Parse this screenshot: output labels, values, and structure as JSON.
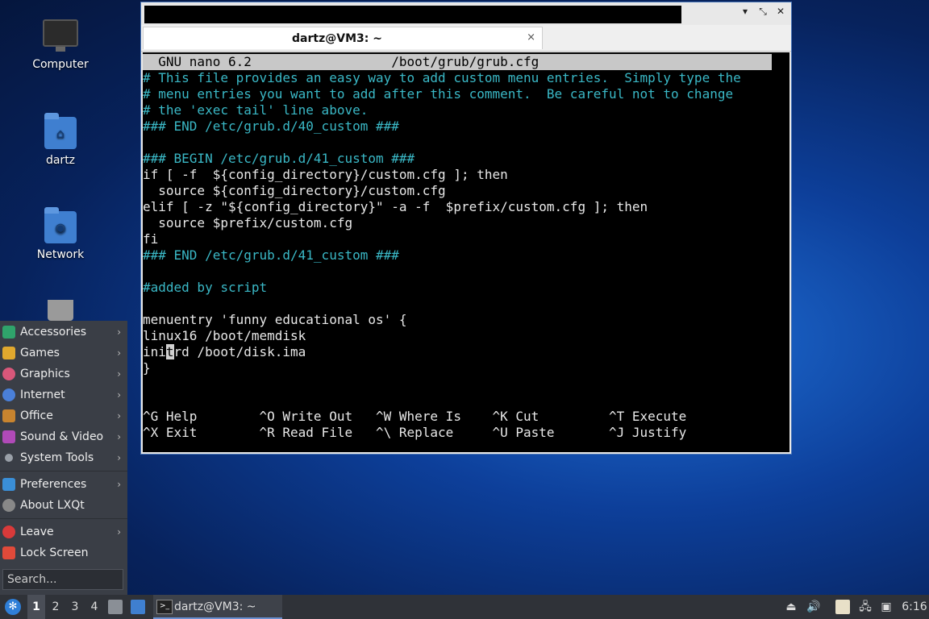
{
  "desktop": {
    "icons": [
      {
        "label": "Computer",
        "icon": "computer-icon"
      },
      {
        "label": "dartz",
        "icon": "home-folder-icon"
      },
      {
        "label": "Network",
        "icon": "network-folder-icon"
      },
      {
        "label": "",
        "icon": "trash-icon"
      }
    ]
  },
  "window": {
    "tab_title": "dartz@VM3: ~",
    "tab_close": "×",
    "controls": {
      "minimize": "▾",
      "maximize": "⤡",
      "close": "✕"
    }
  },
  "terminal": {
    "header": "  GNU nano 6.2                  /boot/grub/grub.cfg",
    "lines": [
      "# This file provides an easy way to add custom menu entries.  Simply type the",
      "# menu entries you want to add after this comment.  Be careful not to change",
      "# the 'exec tail' line above.",
      "### END /etc/grub.d/40_custom ###",
      "",
      "### BEGIN /etc/grub.d/41_custom ###",
      "if [ -f  ${config_directory}/custom.cfg ]; then",
      "  source ${config_directory}/custom.cfg",
      "elif [ -z \"${config_directory}\" -a -f  $prefix/custom.cfg ]; then",
      "  source $prefix/custom.cfg",
      "fi",
      "### END /etc/grub.d/41_custom ###",
      "",
      "#added by script",
      "",
      "menuentry 'funny educational os' {",
      "linux16 /boot/memdisk",
      "",
      "}"
    ],
    "cursor_line": {
      "before": "ini",
      "cursor": "t",
      "after": "rd /boot/disk.ima"
    },
    "shortcuts_row1": "^G Help        ^O Write Out   ^W Where Is    ^K Cut         ^T Execute",
    "shortcuts_row2": "^X Exit        ^R Read File   ^\\ Replace     ^U Paste       ^J Justify"
  },
  "start_menu": {
    "items": [
      {
        "label": "Accessories",
        "submenu": true,
        "color": "#2fa36b"
      },
      {
        "label": "Games",
        "submenu": true,
        "color": "#e0a82e"
      },
      {
        "label": "Graphics",
        "submenu": true,
        "color": "#d8577a"
      },
      {
        "label": "Internet",
        "submenu": true,
        "color": "#4a7fd8"
      },
      {
        "label": "Office",
        "submenu": true,
        "color": "#c8842f"
      },
      {
        "label": "Sound & Video",
        "submenu": true,
        "color": "#b04ab8"
      },
      {
        "label": "System Tools",
        "submenu": true,
        "color": "#9aa0a8"
      },
      {
        "label": "Preferences",
        "submenu": true,
        "color": "#3a8fd8"
      },
      {
        "label": "About LXQt",
        "submenu": false,
        "color": "#888888"
      },
      {
        "label": "Leave",
        "submenu": true,
        "color": "#d83a3a"
      },
      {
        "label": "Lock Screen",
        "submenu": false,
        "color": "#e04a3a"
      }
    ],
    "search_placeholder": "Search..."
  },
  "taskbar": {
    "desktops": [
      "1",
      "2",
      "3",
      "4"
    ],
    "active_desktop": "1",
    "task_label": "dartz@VM3: ~",
    "clock": "6:16"
  }
}
